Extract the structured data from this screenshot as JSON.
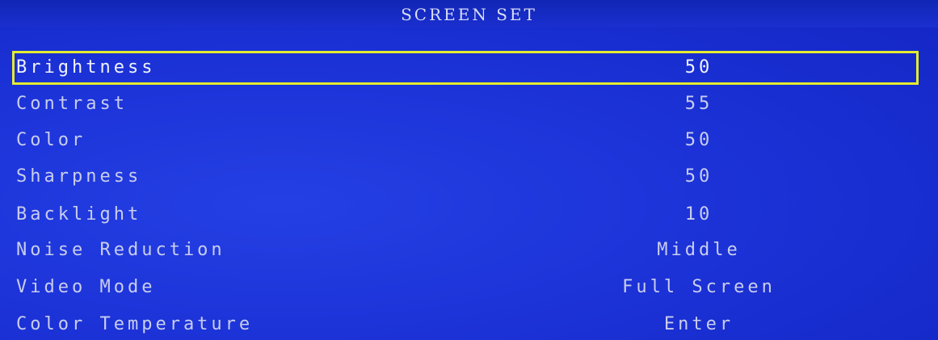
{
  "header": {
    "title": "SCREEN SET"
  },
  "colors": {
    "background": "#1c33d8",
    "selection_border": "#e3ec2e",
    "text": "#c9cdee"
  },
  "menu": {
    "selected_index": 0,
    "items": [
      {
        "label": "Brightness",
        "value": "50"
      },
      {
        "label": "Contrast",
        "value": "55"
      },
      {
        "label": "Color",
        "value": "50"
      },
      {
        "label": "Sharpness",
        "value": "50"
      },
      {
        "label": "Backlight",
        "value": "10"
      },
      {
        "label": "Noise Reduction",
        "value": "Middle"
      },
      {
        "label": "Video Mode",
        "value": "Full Screen"
      },
      {
        "label": "Color Temperature",
        "value": "Enter"
      }
    ]
  }
}
